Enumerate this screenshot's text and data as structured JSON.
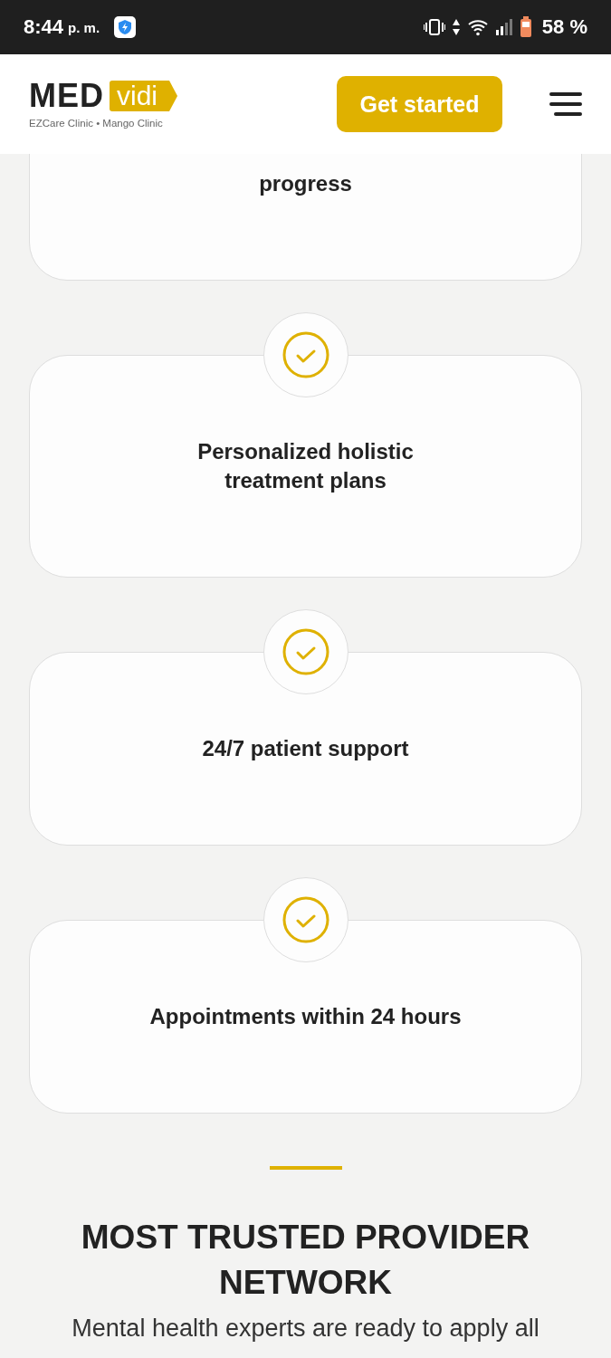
{
  "status_bar": {
    "time": "8:44",
    "period": "p. m.",
    "battery": "58 %"
  },
  "header": {
    "logo": {
      "word": "MED",
      "tag": "vidi",
      "subtitle": "EZCare Clinic • Mango Clinic"
    },
    "cta": "Get started"
  },
  "partial_feature": {
    "title": "progress"
  },
  "features": [
    {
      "title": "Personalized holistic treatment plans"
    },
    {
      "title": "24/7 patient support"
    },
    {
      "title": "Appointments within 24 hours"
    }
  ],
  "section": {
    "heading": "MOST TRUSTED PROVIDER NETWORK",
    "text": "Mental health experts are ready to apply all"
  }
}
